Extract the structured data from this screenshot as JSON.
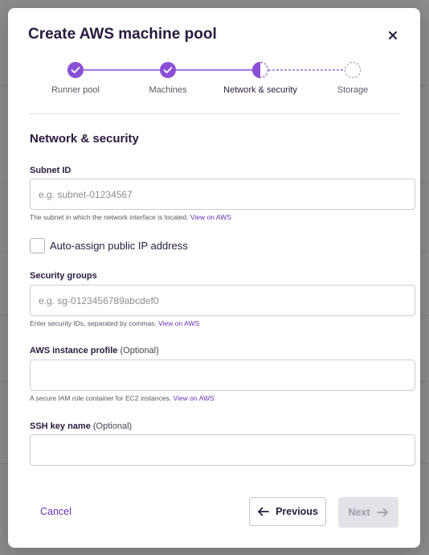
{
  "dialog": {
    "title": "Create AWS machine pool",
    "close_icon": "close-icon"
  },
  "stepper": {
    "steps": [
      {
        "label": "Runner pool",
        "status": "complete"
      },
      {
        "label": "Machines",
        "status": "complete"
      },
      {
        "label": "Network & security",
        "status": "current"
      },
      {
        "label": "Storage",
        "status": "upcoming"
      }
    ]
  },
  "section": {
    "title": "Network & security"
  },
  "fields": {
    "subnet": {
      "label": "Subnet ID",
      "placeholder": "e.g. subnet-01234567",
      "value": "",
      "help": "The subnet in which the network interface is located.",
      "help_link": "View on AWS"
    },
    "public_ip": {
      "label": "Auto-assign public IP address",
      "checked": false
    },
    "security_groups": {
      "label": "Security groups",
      "placeholder": "e.g. sg-0123456789abcdef0",
      "value": "",
      "help": "Enter security IDs, separated by commas.",
      "help_link": "View on AWS"
    },
    "instance_profile": {
      "label": "AWS instance profile",
      "optional": "(Optional)",
      "placeholder": "",
      "value": "",
      "help": "A secure IAM role container for EC2 instances.",
      "help_link": "View on AWS"
    },
    "ssh_key": {
      "label": "SSH key name",
      "optional": "(Optional)",
      "placeholder": "",
      "value": ""
    }
  },
  "footer": {
    "cancel_label": "Cancel",
    "previous_label": "Previous",
    "next_label": "Next",
    "next_disabled": true
  },
  "colors": {
    "accent": "#8a4fd6",
    "accent_dark": "#6b2fb8",
    "text": "#2a1a3f",
    "disabled_bg": "#e4e1e8",
    "overlay": "#8b8b8b"
  }
}
